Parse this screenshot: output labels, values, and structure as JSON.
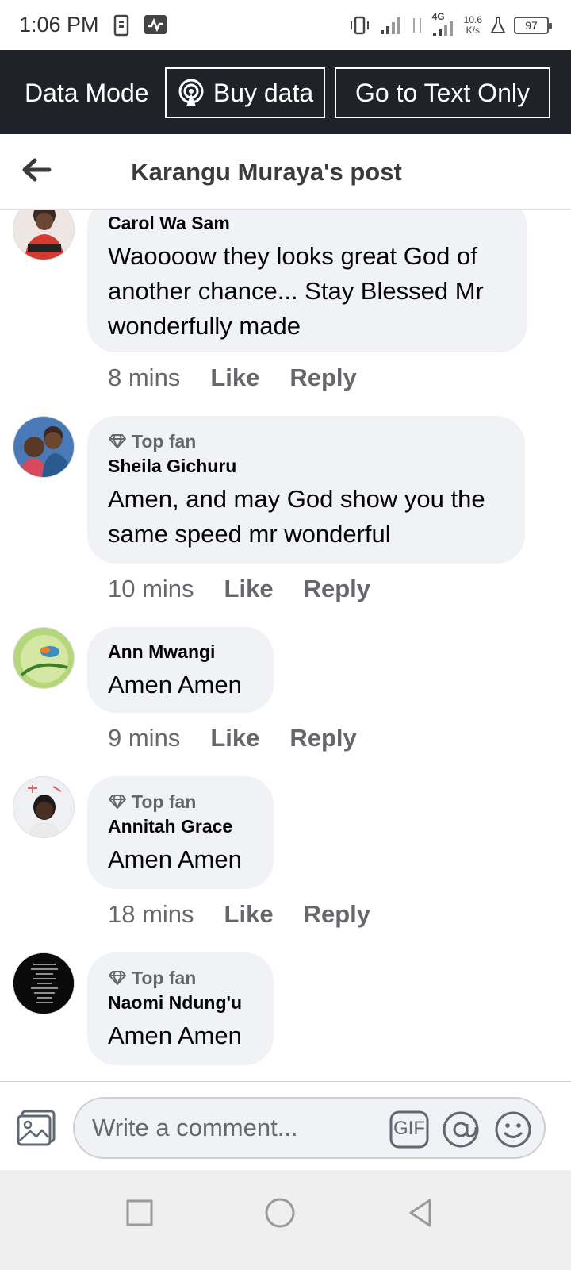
{
  "status_bar": {
    "time": "1:06 PM",
    "network_type": "4G",
    "net_speed_value": "10.6",
    "net_speed_unit": "K/s",
    "battery_level": "97"
  },
  "data_bar": {
    "mode_label": "Data Mode",
    "buy_data_label": "Buy data",
    "text_only_label": "Go to Text Only"
  },
  "header": {
    "title": "Karangu Muraya's post"
  },
  "comments": [
    {
      "author": "Carol Wa Sam",
      "top_fan": false,
      "text": "Waoooow they looks great God of another chance... Stay Blessed Mr wonderfully made",
      "time": "8 mins",
      "like": "Like",
      "reply": "Reply"
    },
    {
      "author": "Sheila Gichuru",
      "top_fan": true,
      "badge": "Top fan",
      "text": "Amen, and may God show you the same speed mr wonderful",
      "time": "10 mins",
      "like": "Like",
      "reply": "Reply"
    },
    {
      "author": "Ann Mwangi",
      "top_fan": false,
      "text": "Amen Amen",
      "time": "9 mins",
      "like": "Like",
      "reply": "Reply"
    },
    {
      "author": "Annitah Grace",
      "top_fan": true,
      "badge": "Top fan",
      "text": "Amen Amen",
      "time": "18 mins",
      "like": "Like",
      "reply": "Reply"
    },
    {
      "author": "Naomi Ndung'u",
      "top_fan": true,
      "badge": "Top fan",
      "text": "Amen Amen"
    }
  ],
  "composer": {
    "placeholder": "Write a comment...",
    "gif_label": "GIF"
  },
  "colors": {
    "data_bar_bg": "#1f2329",
    "bubble_bg": "#f0f2f5",
    "secondary_text": "#65676b"
  }
}
